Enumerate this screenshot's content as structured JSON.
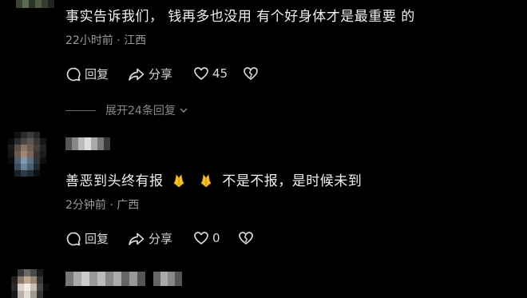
{
  "comments": [
    {
      "text": "事实告诉我们，  钱再多也没用 有个好身体才是最重要 的",
      "meta": "22小时前 · 江西",
      "reply_label": "回复",
      "share_label": "分享",
      "like_count": "45",
      "expand_label": "展开24条回复"
    },
    {
      "text_part1": "善恶到头终有报",
      "text_part2": "不是不报，是时候未到",
      "meta": "2分钟前 · 广西",
      "reply_label": "回复",
      "share_label": "分享",
      "like_count": "0"
    }
  ],
  "icons": {
    "reply": "comment-bubble-icon",
    "share": "share-arrow-icon",
    "like": "heart-icon",
    "dislike": "broken-heart-icon",
    "expand": "chevron-down-icon",
    "emoji": "praying-hands-emoji"
  },
  "colors": {
    "background": "#000000",
    "text": "#f2f2f2",
    "meta": "#9a9a9a"
  }
}
